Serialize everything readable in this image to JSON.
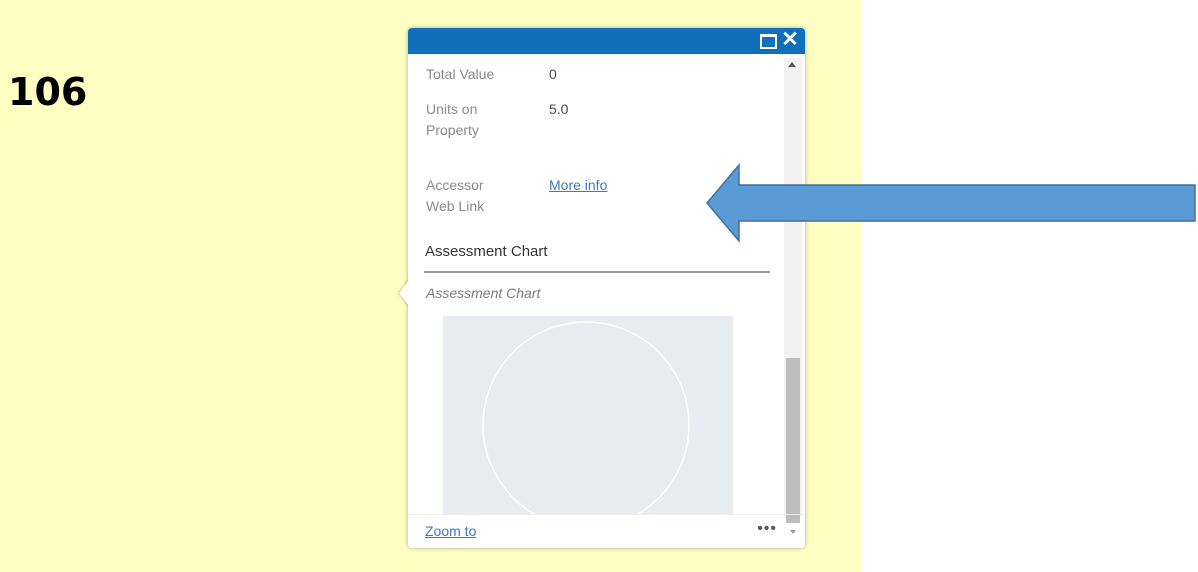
{
  "slide": {
    "number": "106",
    "background_color": "#ffffc4"
  },
  "popup": {
    "header_color": "#0f70b9",
    "maximize_icon": "maximize-icon",
    "close_icon": "close-icon",
    "close_glyph": "✕",
    "attributes": [
      {
        "label": "Total Value",
        "value": "0"
      },
      {
        "label": "Units on Property",
        "value": "5.0"
      },
      {
        "label": "Accessor Web Link",
        "link_text": "More info"
      }
    ],
    "section_title": "Assessment Chart",
    "chart_caption": "Assessment Chart",
    "footer": {
      "zoom_label": "Zoom to",
      "more_glyph": "•••"
    }
  },
  "arrow": {
    "color": "#5b9bd5",
    "stroke_color": "#41719c",
    "direction": "left"
  }
}
